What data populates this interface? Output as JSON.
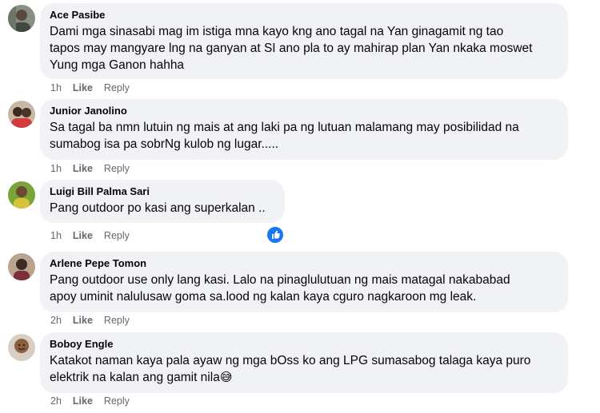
{
  "colors": {
    "bubble": "#f0f2f5",
    "meta": "#65676b",
    "like_blue": "#1877f2"
  },
  "comments": [
    {
      "author": "Ace Pasibe",
      "text": "Dami mga sinasabi mag im istiga mna kayo kng ano tagal na Yan ginagamit ng tao\ntapos may mangyare lng na ganyan at SI ano pla to ay mahirap plan Yan nkaka moswet\nYung mga Ganon hahha",
      "time": "1h",
      "like": "Like",
      "reply": "Reply"
    },
    {
      "author": "Junior Janolino",
      "text": "Sa tagal ba nmn lutuin ng mais at ang laki pa ng lutuan malamang may posibilidad na\nsumabog isa pa sobrNg kulob ng lugar.....",
      "time": "1h",
      "like": "Like",
      "reply": "Reply"
    },
    {
      "author": "Luigi Bill Palma Sari",
      "text": "Pang outdoor po kasi ang superkalan ..",
      "time": "1h",
      "like": "Like",
      "reply": "Reply",
      "reaction_icon": "like-thumb-icon"
    },
    {
      "author": "Arlene Pepe Tomon",
      "text": "Pang outdoor use only lang kasi. Lalo na pinaglulutuan ng mais matagal nakababad\napoy uminit nalulusaw goma sa.lood ng kalan kaya cguro nagkaroon mg leak.",
      "time": "2h",
      "like": "Like",
      "reply": "Reply"
    },
    {
      "author": "Boboy Engle",
      "text": "Katakot naman kaya pala ayaw ng mga bOss ko ang LPG sumasabog talaga kaya puro\nelektrik na kalan ang gamit nila",
      "emoji": "😅",
      "time": "2h",
      "like": "Like",
      "reply": "Reply"
    }
  ]
}
